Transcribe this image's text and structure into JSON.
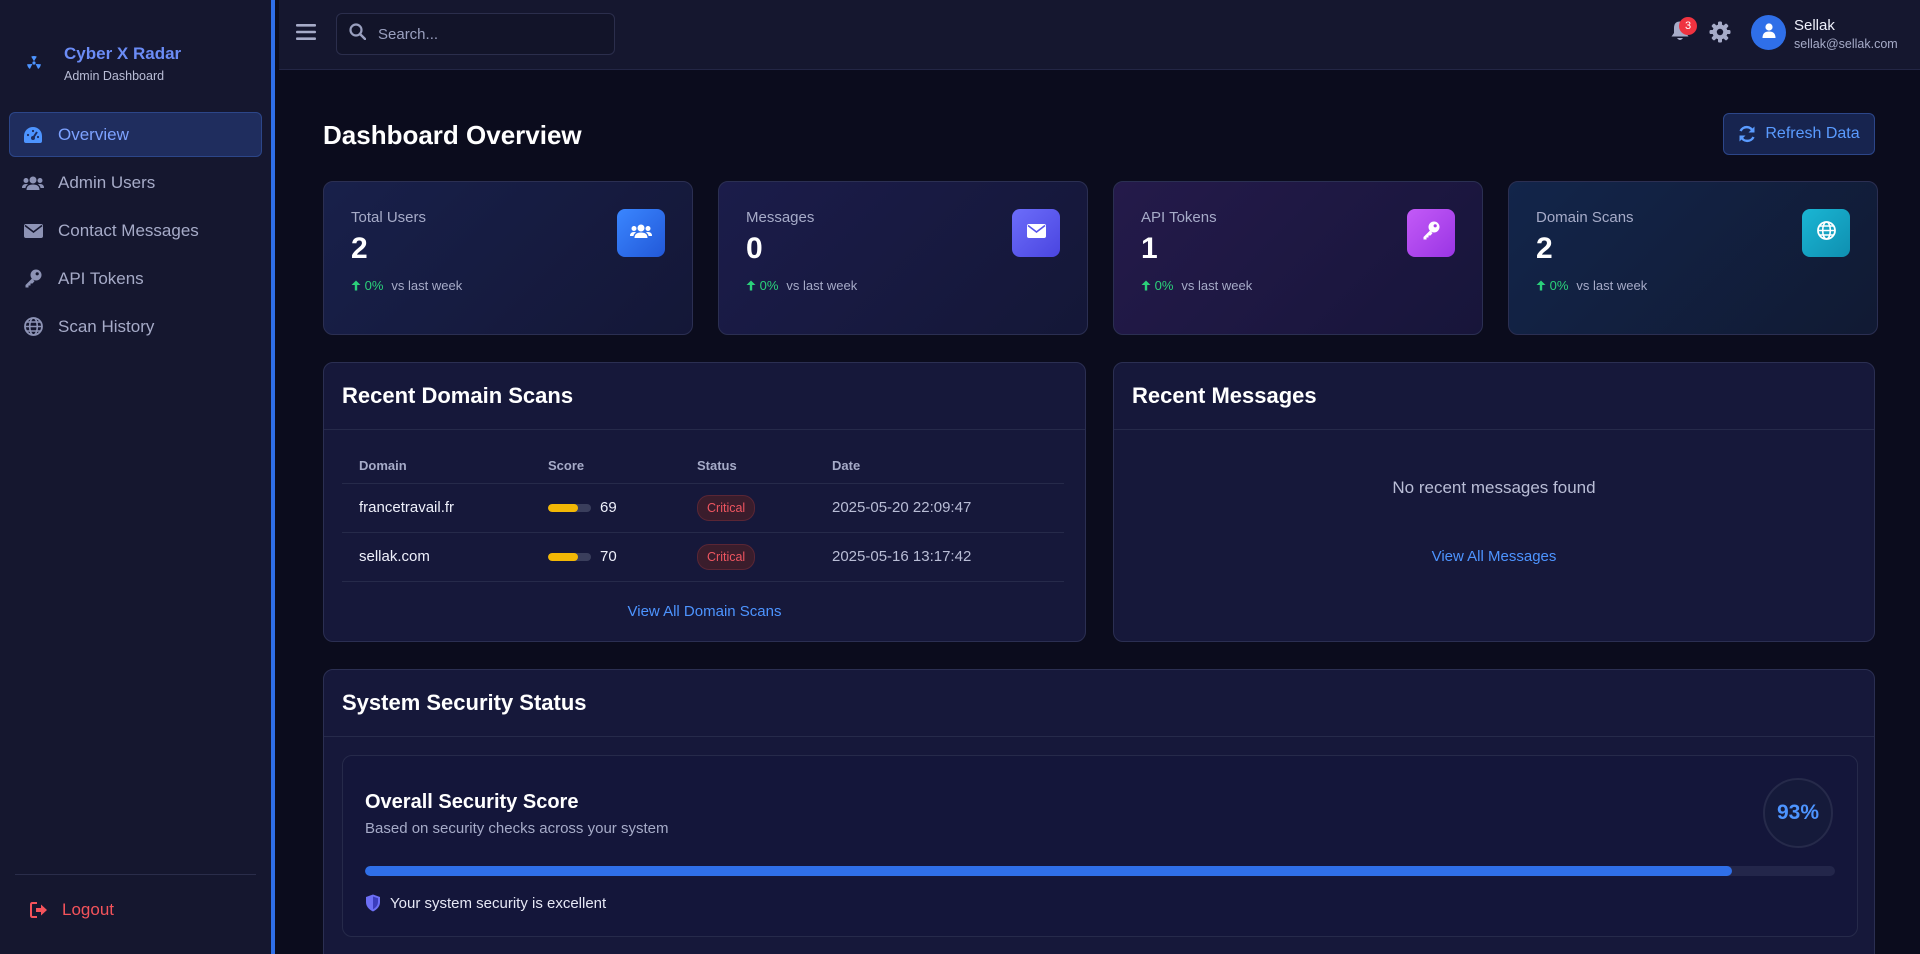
{
  "brand": {
    "title": "Cyber X Radar",
    "subtitle": "Admin Dashboard",
    "icon": "radiation-icon"
  },
  "sidebar": {
    "items": [
      {
        "label": "Overview",
        "icon": "gauge-icon",
        "active": true
      },
      {
        "label": "Admin Users",
        "icon": "users-icon"
      },
      {
        "label": "Contact Messages",
        "icon": "envelope-icon"
      },
      {
        "label": "API Tokens",
        "icon": "key-icon"
      },
      {
        "label": "Scan History",
        "icon": "globe-icon"
      }
    ],
    "logout_label": "Logout"
  },
  "topbar": {
    "search_placeholder": "Search...",
    "notification_count": "3",
    "user": {
      "name": "Sellak",
      "email": "sellak@sellak.com"
    }
  },
  "page": {
    "title": "Dashboard Overview",
    "refresh_label": "Refresh Data"
  },
  "stats": [
    {
      "label": "Total Users",
      "value": "2",
      "trend": "0%",
      "trend_note": "vs last week",
      "icon": "users-icon",
      "color": "#2f6fe8"
    },
    {
      "label": "Messages",
      "value": "0",
      "trend": "0%",
      "trend_note": "vs last week",
      "icon": "envelope-icon",
      "color": "#5b5cf0"
    },
    {
      "label": "API Tokens",
      "value": "1",
      "trend": "0%",
      "trend_note": "vs last week",
      "icon": "key-icon",
      "color": "#b445f0"
    },
    {
      "label": "Domain Scans",
      "value": "2",
      "trend": "0%",
      "trend_note": "vs last week",
      "icon": "globe-icon",
      "color": "#12a6c4"
    }
  ],
  "recent_scans": {
    "title": "Recent Domain Scans",
    "columns": [
      "Domain",
      "Score",
      "Status",
      "Date"
    ],
    "rows": [
      {
        "domain": "francetravail.fr",
        "score": "69",
        "status": "Critical",
        "date": "2025-05-20 22:09:47"
      },
      {
        "domain": "sellak.com",
        "score": "70",
        "status": "Critical",
        "date": "2025-05-16 13:17:42"
      }
    ],
    "link_label": "View All Domain Scans"
  },
  "recent_messages": {
    "title": "Recent Messages",
    "empty_text": "No recent messages found",
    "link_label": "View All Messages"
  },
  "security": {
    "title": "System Security Status",
    "score_title": "Overall Security Score",
    "score_subtitle": "Based on security checks across your system",
    "score": "93%",
    "score_value": 0.93,
    "note": "Your system security is excellent"
  },
  "colors": {
    "accent": "#2f6fe8",
    "critical": "#ee5560",
    "score_bar": "#f2b705",
    "trend_up": "#2bd07a"
  }
}
